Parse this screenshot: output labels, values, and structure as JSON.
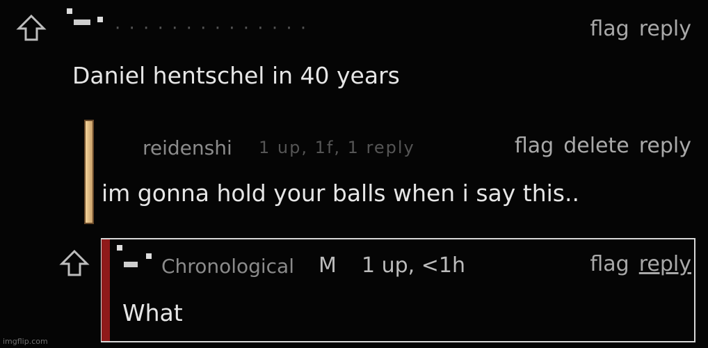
{
  "comment1": {
    "body": "Daniel hentschel in 40 years",
    "actions": {
      "flag": "flag",
      "reply": "reply"
    }
  },
  "comment2": {
    "username": "reidenshi",
    "blurred_meta": "1 up, 1f, 1 reply",
    "body": "im gonna hold your balls when i say this..",
    "actions": {
      "flag": "flag",
      "delete": "delete",
      "reply": "reply"
    },
    "bar_color": "#e0b87a"
  },
  "comment3": {
    "username": "Chronological",
    "badge": "M",
    "meta": "1 up, <1h",
    "body": "What",
    "actions": {
      "flag": "flag",
      "reply": "reply"
    },
    "bar_color": "#8f1a1a"
  },
  "watermark": "imgflip.com",
  "icons": {
    "upvote": "upvote-arrow-icon",
    "avatar": "avatar-icon"
  }
}
